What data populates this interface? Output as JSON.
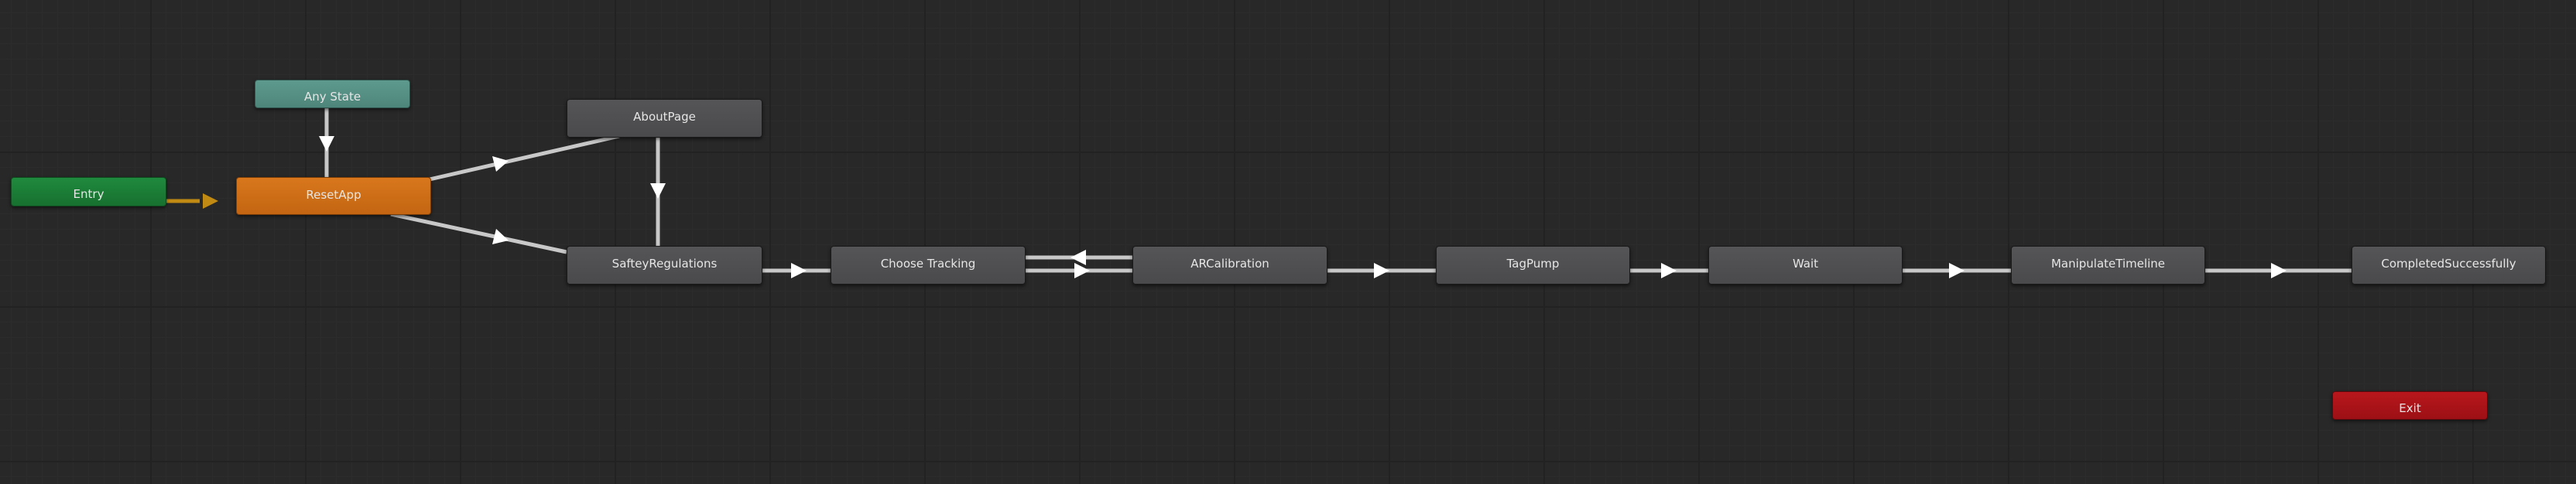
{
  "editor": "Animator state machine graph",
  "states": {
    "any_state": "Any State",
    "entry": "Entry",
    "reset_app": "ResetApp",
    "about_page": "AboutPage",
    "saftey_regulations": "SafteyRegulations",
    "choose_tracking": "Choose Tracking",
    "ar_calibration": "ARCalibration",
    "tag_pump": "TagPump",
    "wait": "Wait",
    "manipulate_timeline": "ManipulateTimeline",
    "completed_successfully": "CompletedSuccessfully",
    "exit": "Exit"
  },
  "colors": {
    "background": "#282828",
    "state_gray": "#505052",
    "entry_green": "#1b7d37",
    "any_state_teal": "#568f84",
    "default_state_orange": "#cc6e16",
    "exit_red": "#aa1418",
    "transition_line": "#c8c8c8",
    "default_transition": "#c08a13"
  }
}
